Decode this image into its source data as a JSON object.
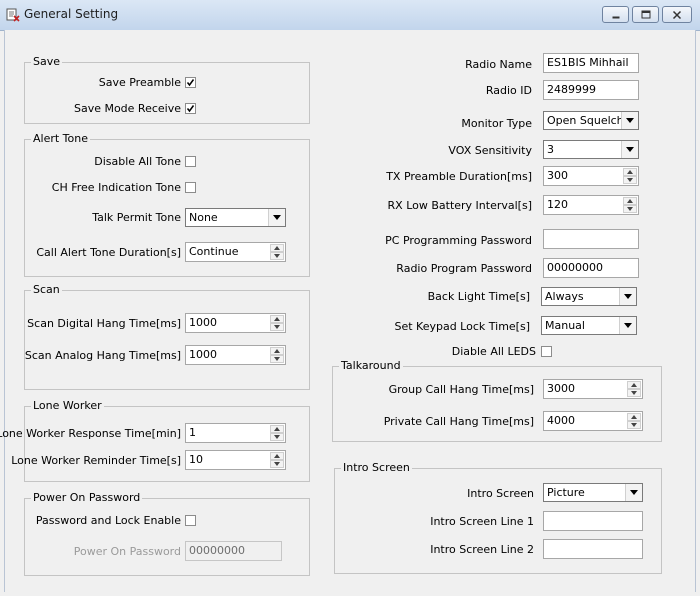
{
  "window": {
    "title": "General Setting"
  },
  "save": {
    "group": "Save",
    "save_preamble": "Save Preamble",
    "save_mode_receive": "Save Mode Receive"
  },
  "alert": {
    "group": "Alert Tone",
    "disable_all_tone": "Disable All Tone",
    "ch_free": "CH Free Indication Tone",
    "talk_permit": "Talk Permit Tone",
    "talk_permit_value": "None",
    "call_alert": "Call Alert Tone Duration[s]",
    "call_alert_value": "Continue"
  },
  "scan": {
    "group": "Scan",
    "digital": "Scan Digital Hang Time[ms]",
    "digital_value": "1000",
    "analog": "Scan Analog Hang Time[ms]",
    "analog_value": "1000"
  },
  "lone": {
    "group": "Lone Worker",
    "response": "Lone Worker Response Time[min]",
    "response_value": "1",
    "reminder": "Lone Worker Reminder Time[s]",
    "reminder_value": "10"
  },
  "power": {
    "group": "Power On Password",
    "lock_enable": "Password and Lock Enable",
    "password": "Power On Password",
    "password_value": "00000000"
  },
  "right": {
    "radio_name": "Radio Name",
    "radio_name_value": "ES1BIS Mihhail",
    "radio_id": "Radio ID",
    "radio_id_value": "2489999",
    "monitor_type": "Monitor Type",
    "monitor_type_value": "Open Squelch",
    "vox": "VOX Sensitivity",
    "vox_value": "3",
    "tx_preamble": "TX Preamble Duration[ms]",
    "tx_preamble_value": "300",
    "rx_low": "RX Low Battery Interval[s]",
    "rx_low_value": "120",
    "pc_pwd": "PC Programming Password",
    "pc_pwd_value": "",
    "radio_pwd": "Radio Program Password",
    "radio_pwd_value": "00000000",
    "backlight": "Back Light Time[s]",
    "backlight_value": "Always",
    "keypad": "Set Keypad Lock Time[s]",
    "keypad_value": "Manual",
    "disable_leds": "Diable All LEDS"
  },
  "talkaround": {
    "group": "Talkaround",
    "group_call": "Group Call Hang Time[ms]",
    "group_call_value": "3000",
    "private_call": "Private Call Hang Time[ms]",
    "private_call_value": "4000"
  },
  "intro": {
    "group": "Intro Screen",
    "screen": "Intro Screen",
    "screen_value": "Picture",
    "line1": "Intro Screen Line 1",
    "line1_value": "",
    "line2": "Intro Screen Line 2",
    "line2_value": ""
  }
}
